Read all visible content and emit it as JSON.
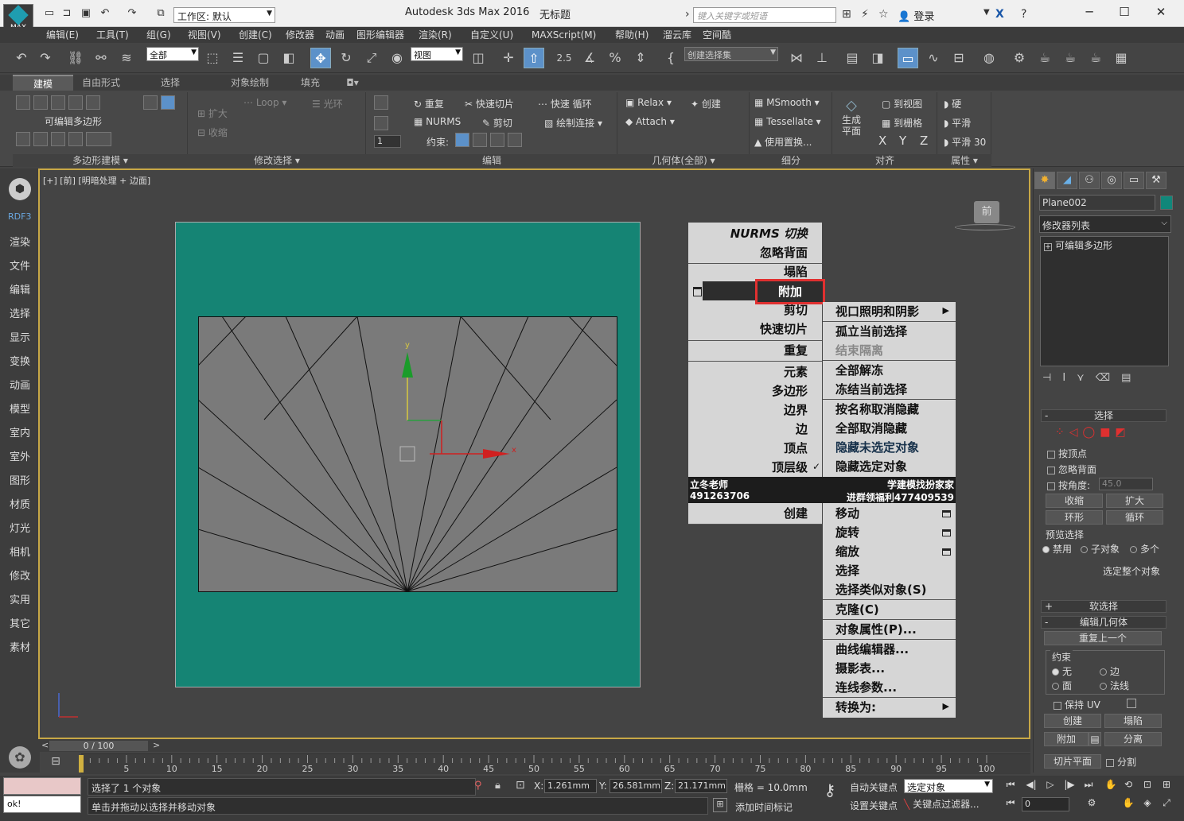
{
  "titlebar": {
    "logo_text": "MAX",
    "workspace_label": "工作区: 默认",
    "app_title": "Autodesk 3ds Max 2016",
    "doc_title": "无标题",
    "search_placeholder": "键入关键字或短语",
    "login_label": "登录"
  },
  "menubar": [
    "编辑(E)",
    "工具(T)",
    "组(G)",
    "视图(V)",
    "创建(C)",
    "修改器",
    "动画",
    "图形编辑器",
    "渲染(R)",
    "自定义(U)",
    "MAXScript(M)",
    "帮助(H)",
    "溜云库",
    "空间酷"
  ],
  "toolbar": {
    "filter_value": "全部",
    "refcoord_value": "视图",
    "snap_25": "2.5",
    "named_selset_placeholder": "创建选择集"
  },
  "ribbon": {
    "tabs": [
      "建模",
      "自由形式",
      "选择",
      "对象绘制",
      "填充"
    ],
    "active_tab": "建模",
    "poly_modeling_label": "可编辑多边形",
    "expand_label": "扩大",
    "shrink_label": "收缩",
    "loop_label": "Loop",
    "ring_label": "光环",
    "repeat_label": "重复",
    "quickslice_label": "快速切片",
    "quickloop_label": "快速 循环",
    "nurms_label": "NURMS",
    "cut_label": "剪切",
    "paintconnect_label": "绘制连接",
    "constrain_label": "约束:",
    "spinner_value": "1",
    "relax_label": "Relax",
    "create_label": "创建",
    "attach_label": "Attach",
    "msmooth_label": "MSmooth",
    "tessellate_label": "Tessellate",
    "use_displace_label": "使用置换...",
    "make_planar_label": "生成平面",
    "to_view_label": "到视图",
    "to_grid_label": "到栅格",
    "x_label": "X",
    "y_label": "Y",
    "z_label": "Z",
    "hard_label": "硬",
    "smooth_label": "平滑",
    "smooth30_label": "平滑 30",
    "footers": [
      "多边形建模",
      "修改选择",
      "编辑",
      "几何体(全部)",
      "细分",
      "对齐",
      "属性"
    ]
  },
  "leftstrip": {
    "rdf3": "RDF3",
    "items": [
      "渲染",
      "文件",
      "编辑",
      "选择",
      "显示",
      "变换",
      "动画",
      "模型",
      "室内",
      "室外",
      "图形",
      "材质",
      "灯光",
      "相机",
      "修改",
      "实用",
      "其它",
      "素材"
    ]
  },
  "viewport": {
    "label": "[+] [前] [明暗处理 + 边面]",
    "viewcube_label": "前",
    "gizmo_x": "x",
    "gizmo_y": "y"
  },
  "quadmenu": {
    "left": {
      "nurms": "NURMS 切换",
      "ignore_backface": "忽略背面",
      "collapse": "塌陷",
      "attach": "附加",
      "cut": "剪切",
      "quickslice": "快速切片",
      "repeat": "重复",
      "element": "元素",
      "polygon": "多边形",
      "border": "边界",
      "edge": "边",
      "vertex": "顶点",
      "toplevel": "顶层级",
      "create": "创建"
    },
    "right": {
      "viewport_lighting": "视口照明和阴影",
      "isolate": "孤立当前选择",
      "end_isolate": "结束隔离",
      "unfreeze_all": "全部解冻",
      "freeze_sel": "冻结当前选择",
      "unhide_by_name": "按名称取消隐藏",
      "unhide_all": "全部取消隐藏",
      "hide_unsel": "隐藏未选定对象",
      "hide_sel": "隐藏选定对象",
      "move": "移动",
      "rotate": "旋转",
      "scale": "缩放",
      "select": "选择",
      "select_similar": "选择类似对象(S)",
      "clone": "克隆(C)",
      "obj_props": "对象属性(P)...",
      "curve_editor": "曲线编辑器...",
      "dope_sheet": "摄影表...",
      "wire_params": "连线参数...",
      "convert_to": "转换为:"
    },
    "banner": {
      "left1": "立冬老师",
      "right1": "学建模找扮家家",
      "left2": "491263706",
      "right2": "进群领福利477409539"
    }
  },
  "rightpanel": {
    "object_name": "Plane002",
    "object_color": "#11877a",
    "modifier_list": "修改器列表",
    "stack_item": "可编辑多边形",
    "selection_title": "选择",
    "by_vertex": "按顶点",
    "ignore_backface": "忽略背面",
    "by_angle": "按角度:",
    "angle_value": "45.0",
    "shrink": "收缩",
    "grow": "扩大",
    "ring": "环形",
    "loop": "循环",
    "preview_sel": "预览选择",
    "disabled": "禁用",
    "subobject": "子对象",
    "multi": "多个",
    "select_whole": "选定整个对象",
    "soft_sel": "软选择",
    "edit_geom": "编辑几何体",
    "repeat_last": "重复上一个",
    "constraints": "约束",
    "c_none": "无",
    "c_edge": "边",
    "c_face": "面",
    "c_normal": "法线",
    "keep_uv": "保持 UV",
    "create": "创建",
    "collapse": "塌陷",
    "attach": "附加",
    "detach": "分离",
    "slice_plane": "切片平面",
    "split": "分割"
  },
  "timeline": {
    "slider": "0 / 100",
    "ticks": [
      "5",
      "10",
      "15",
      "20",
      "25",
      "30",
      "35",
      "40",
      "45",
      "50",
      "55",
      "60",
      "65",
      "70",
      "75",
      "80",
      "85",
      "90",
      "95",
      "100"
    ]
  },
  "statusbar": {
    "ok_text": "ok!",
    "selection_info": "选择了 1 个对象",
    "hint": "单击并拖动以选择并移动对象",
    "x_label": "X:",
    "x_value": "1.261mm",
    "y_label": "Y:",
    "y_value": "26.581mm",
    "z_label": "Z:",
    "z_value": "21.171mm",
    "grid": "栅格 = 10.0mm",
    "add_time_tag": "添加时间标记",
    "auto_key": "自动关键点",
    "set_key": "设置关键点",
    "selset_value": "选定对象",
    "key_filters": "关键点过滤器...",
    "frame_value": "0"
  }
}
